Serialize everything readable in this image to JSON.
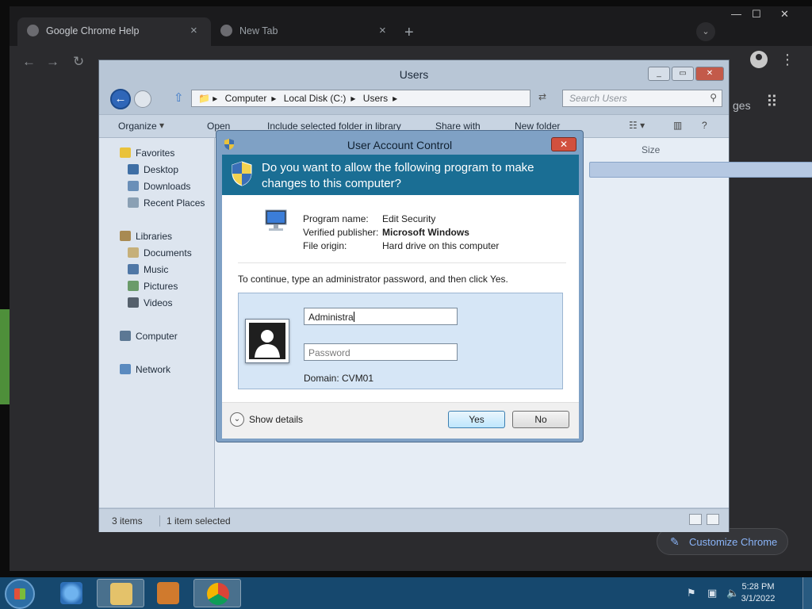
{
  "browser": {
    "tabs": [
      {
        "title": "Google Chrome Help",
        "close": "×"
      },
      {
        "title": "New Tab",
        "close": "×"
      }
    ],
    "new_tab": "+",
    "tab_search": "⌄",
    "window_controls": {
      "minimize": "—",
      "maximize": "☐",
      "close": "✕"
    },
    "nav": {
      "back": "←",
      "forward": "→",
      "reload": "↻"
    },
    "partial_text": "ges",
    "customize": "Customize Chrome"
  },
  "explorer": {
    "title": "Users",
    "breadcrumb": [
      "Computer",
      "Local Disk (C:)",
      "Users"
    ],
    "search_placeholder": "Search Users",
    "commands": [
      "Organize",
      "Open",
      "Include selected folder in library",
      "Share with",
      "New folder"
    ],
    "column_header": "Size",
    "nav": {
      "favorites": "Favorites",
      "favorites_items": [
        "Desktop",
        "Downloads",
        "Recent Places"
      ],
      "libraries": "Libraries",
      "libraries_items": [
        "Documents",
        "Music",
        "Pictures",
        "Videos"
      ],
      "computer": "Computer",
      "network": "Network"
    },
    "status": {
      "items": "3 items",
      "selected": "1 item selected"
    }
  },
  "uac": {
    "title": "User Account Control",
    "close": "✕",
    "question_line1": "Do you want to allow the following program to make",
    "question_line2": "changes to this computer?",
    "labels": {
      "program": "Program name:",
      "publisher": "Verified publisher:",
      "origin": "File origin:"
    },
    "values": {
      "program": "Edit Security",
      "publisher": "Microsoft Windows",
      "origin": "Hard drive on this computer"
    },
    "instruction": "To continue, type an administrator password, and then click Yes.",
    "username_value": "Administra",
    "password_placeholder": "Password",
    "domain": "Domain: CVM01",
    "show_details": "Show details",
    "details_glyph": "⌄",
    "yes": "Yes",
    "no": "No"
  },
  "taskbar": {
    "time": "5:28 PM",
    "date": "3/1/2022"
  },
  "colors": {
    "uac_banner": "#1a6e94",
    "taskbar": "#16486e",
    "chrome_dark": "#2b2b2e",
    "accent_link": "#8ab4f8"
  }
}
